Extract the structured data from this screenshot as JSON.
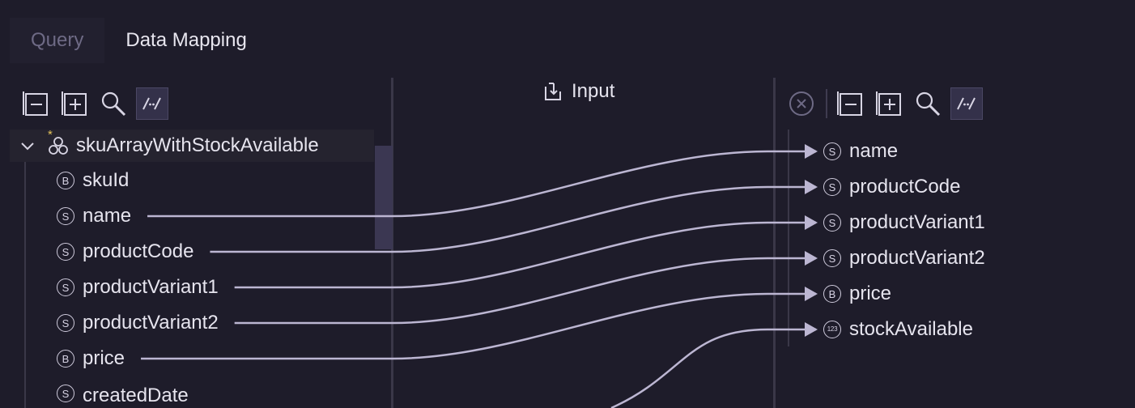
{
  "tabs": [
    {
      "label": "Query",
      "active": false
    },
    {
      "label": "Data Mapping",
      "active": true
    }
  ],
  "input_header": {
    "label": "Input",
    "icon": "import-icon"
  },
  "toolbar": {
    "collapse_icon": "collapse-all-icon",
    "expand_icon": "expand-all-icon",
    "search_icon": "search-icon",
    "link_toggle_icon": "link-lines-icon",
    "clear_icon": "clear-circle-icon"
  },
  "source": {
    "root": {
      "label": "skuArrayWithStockAvailable",
      "icon": "nodes-group-icon",
      "modified_marker": "*"
    },
    "fields": [
      {
        "type": "B",
        "label": "skuId"
      },
      {
        "type": "S",
        "label": "name"
      },
      {
        "type": "S",
        "label": "productCode"
      },
      {
        "type": "S",
        "label": "productVariant1"
      },
      {
        "type": "S",
        "label": "productVariant2"
      },
      {
        "type": "B",
        "label": "price"
      },
      {
        "type": "S",
        "label": "createdDate"
      }
    ]
  },
  "target": {
    "fields": [
      {
        "type": "S",
        "label": "name"
      },
      {
        "type": "S",
        "label": "productCode"
      },
      {
        "type": "S",
        "label": "productVariant1"
      },
      {
        "type": "S",
        "label": "productVariant2"
      },
      {
        "type": "B",
        "label": "price"
      },
      {
        "type": "123",
        "label": "stockAvailable"
      }
    ]
  },
  "mappings": [
    {
      "from": 1,
      "to": 0
    },
    {
      "from": 2,
      "to": 1
    },
    {
      "from": 3,
      "to": 2
    },
    {
      "from": 4,
      "to": 3
    },
    {
      "from": 5,
      "to": 4
    },
    {
      "from": 7,
      "to": 5
    }
  ],
  "colors": {
    "line": "#bcb6d2",
    "background": "#1e1c2a",
    "accent": "#34314a"
  }
}
